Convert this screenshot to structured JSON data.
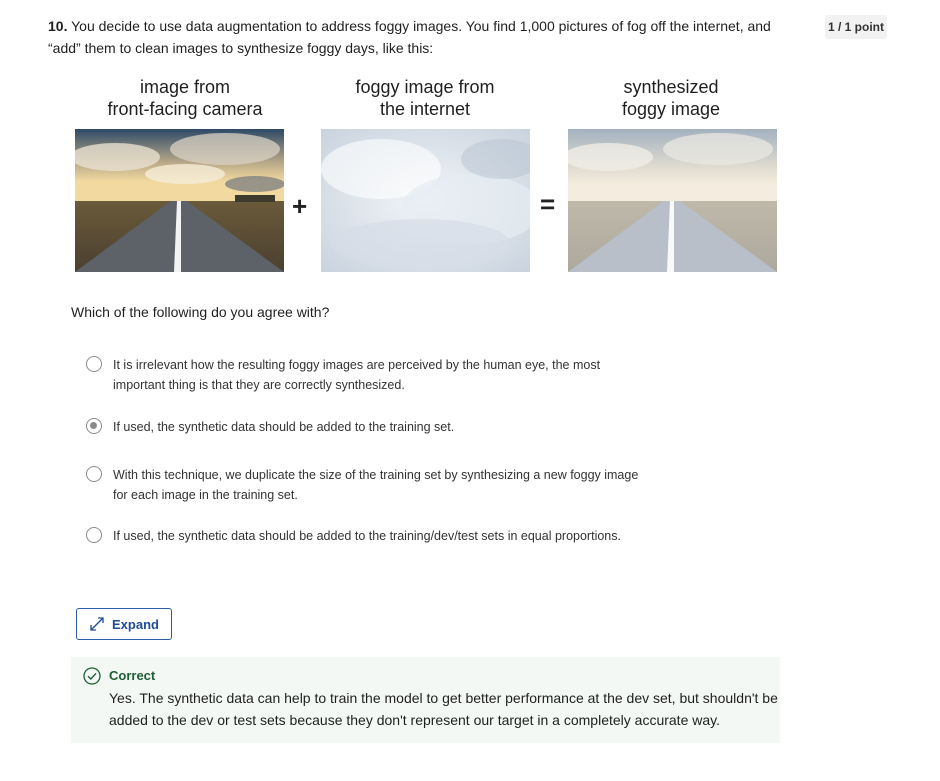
{
  "question": {
    "number": "10.",
    "text": "You decide to use data augmentation to address foggy images. You find 1,000 pictures of fog off the internet, and “add” them to clean images to synthesize foggy days, like this:",
    "points": "1 / 1 point"
  },
  "figure": {
    "captions": [
      {
        "line1": "image from",
        "line2": "front-facing camera"
      },
      {
        "line1": "foggy image from",
        "line2": "the internet"
      },
      {
        "line1": "synthesized",
        "line2": "foggy image"
      }
    ],
    "plus": "+",
    "equals": "="
  },
  "prompt": "Which of the following do you agree with?",
  "options": [
    {
      "text": "It is irrelevant how the resulting foggy images are perceived by the human eye, the most important thing is that they are correctly synthesized.",
      "selected": false
    },
    {
      "text": "If used, the synthetic data should be added to the training set.",
      "selected": true
    },
    {
      "text": "With this technique, we duplicate the size of the training set by synthesizing a new foggy image for each image in the training set.",
      "selected": false
    },
    {
      "text": "If used, the synthetic data should be added to the training/dev/test sets in equal proportions.",
      "selected": false
    }
  ],
  "expand": {
    "label": "Expand",
    "icon": "expand-arrows-icon"
  },
  "feedback": {
    "status": "Correct",
    "icon": "check-circle-icon",
    "text": "Yes. The synthetic data can help to train the model to get better performance at the dev set, but shouldn't be added to the dev or test sets because they don't represent our target in a completely accurate way.",
    "accent": "#1e5e34"
  }
}
